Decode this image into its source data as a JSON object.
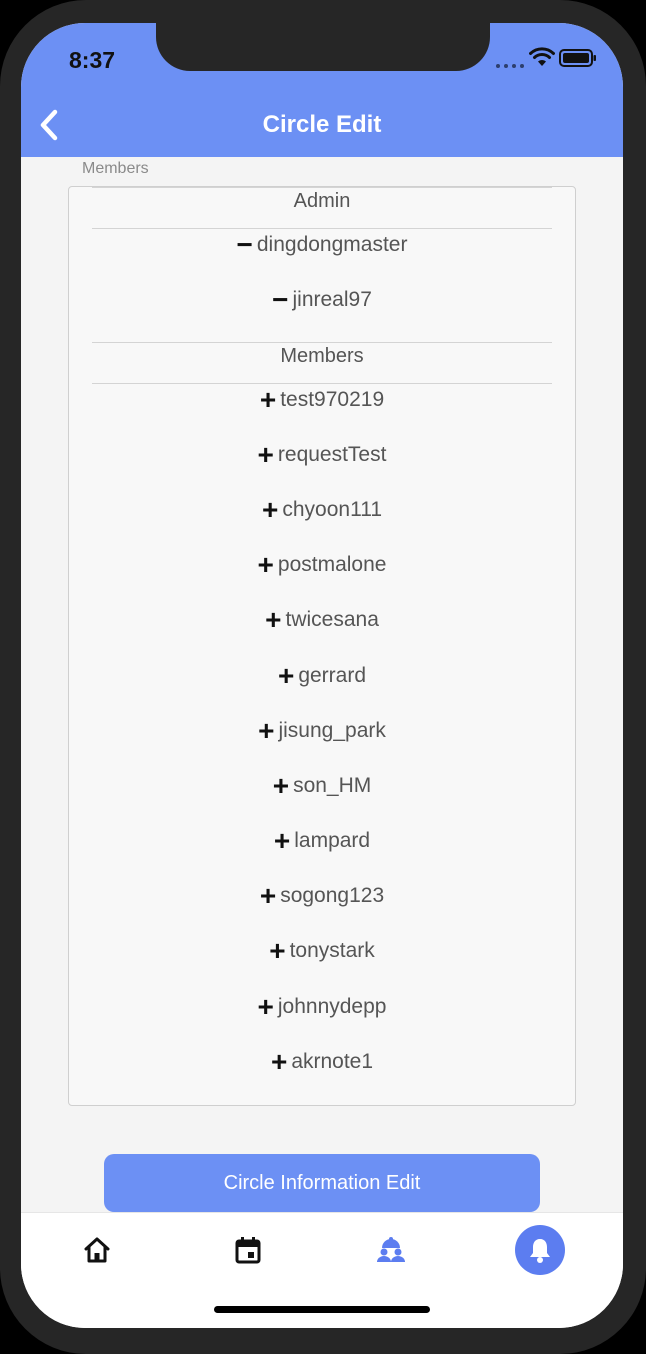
{
  "status_bar": {
    "time": "8:37"
  },
  "header": {
    "title": "Circle Edit"
  },
  "section_label": "Members",
  "admin": {
    "header": "Admin",
    "items": [
      "dingdongmaster",
      "jinreal97"
    ],
    "action_symbol": "−"
  },
  "members": {
    "header": "Members",
    "items": [
      "test970219",
      "requestTest",
      "chyoon111",
      "postmalone",
      "twicesana",
      "gerrard",
      "jisung_park",
      "son_HM",
      "lampard",
      "sogong123",
      "tonystark",
      "johnnydepp",
      "akrnote1"
    ],
    "action_symbol": "+"
  },
  "edit_button": {
    "label": "Circle Information Edit"
  },
  "tabs": [
    {
      "icon": "home-icon"
    },
    {
      "icon": "calendar-icon"
    },
    {
      "icon": "group-icon"
    },
    {
      "icon": "bell-icon"
    }
  ],
  "colors": {
    "accent": "#6c90f4",
    "active_tab": "#5c7df0"
  }
}
